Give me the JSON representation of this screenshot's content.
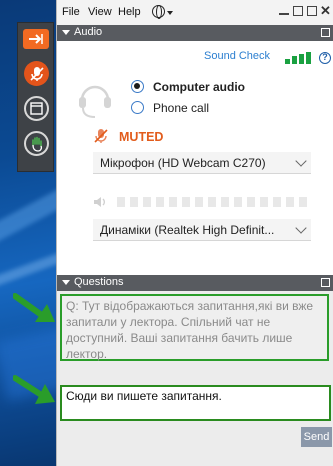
{
  "menu": {
    "file": "File",
    "view": "View",
    "help": "Help"
  },
  "audio": {
    "header": "Audio",
    "sound_check": "Sound Check",
    "computer_audio": "Computer audio",
    "phone_call": "Phone call",
    "muted": "MUTED",
    "microphone": "Мікрофон (HD Webcam C270)",
    "speakers": "Динаміки (Realtek  High Definit..."
  },
  "questions": {
    "header": "Questions",
    "log_text": "Q: Тут відображаються запитання,які ви вже запитали у лектора. Спільний чат не доступний. Ваші запитання бачить лише лектор.",
    "input_text": "Сюди ви пишете запитання.",
    "send_label": "Send"
  },
  "colors": {
    "accent_orange": "#f26a22",
    "link_blue": "#2c7fd0",
    "annotation_green": "#2a9d2a"
  },
  "icons": [
    "arrow-icon",
    "mic-muted-icon",
    "window-icon",
    "hand-icon",
    "globe-icon",
    "headset-icon",
    "speaker-icon",
    "help-icon"
  ]
}
